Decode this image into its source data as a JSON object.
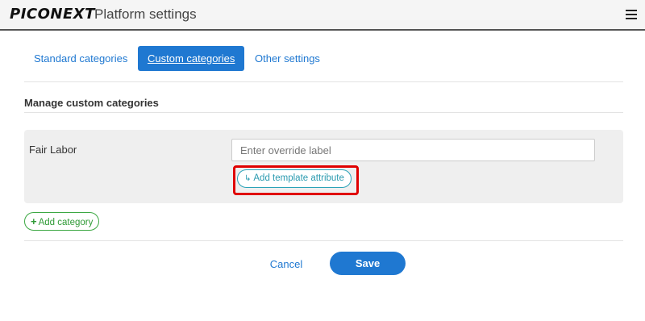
{
  "header": {
    "logo_text": "PICONEXT",
    "title": "Platform settings",
    "menu_icon": "hamburger-menu-icon"
  },
  "tabs": [
    {
      "label": "Standard categories",
      "active": false
    },
    {
      "label": "Custom categories",
      "active": true
    },
    {
      "label": "Other settings",
      "active": false
    }
  ],
  "section": {
    "title": "Manage custom categories"
  },
  "category_row": {
    "label": "Fair Labor",
    "override_input_value": "",
    "override_input_placeholder": "Enter override label",
    "add_attribute_icon": "return-arrow-icon",
    "add_attribute_label": "Add template attribute"
  },
  "add_category": {
    "icon": "plus-icon",
    "label": "Add category"
  },
  "footer": {
    "cancel_label": "Cancel",
    "save_label": "Save"
  },
  "colors": {
    "primary": "#1f78d1",
    "highlight": "#e00000",
    "teal": "#2a9bb0",
    "green": "#2f9a36"
  }
}
